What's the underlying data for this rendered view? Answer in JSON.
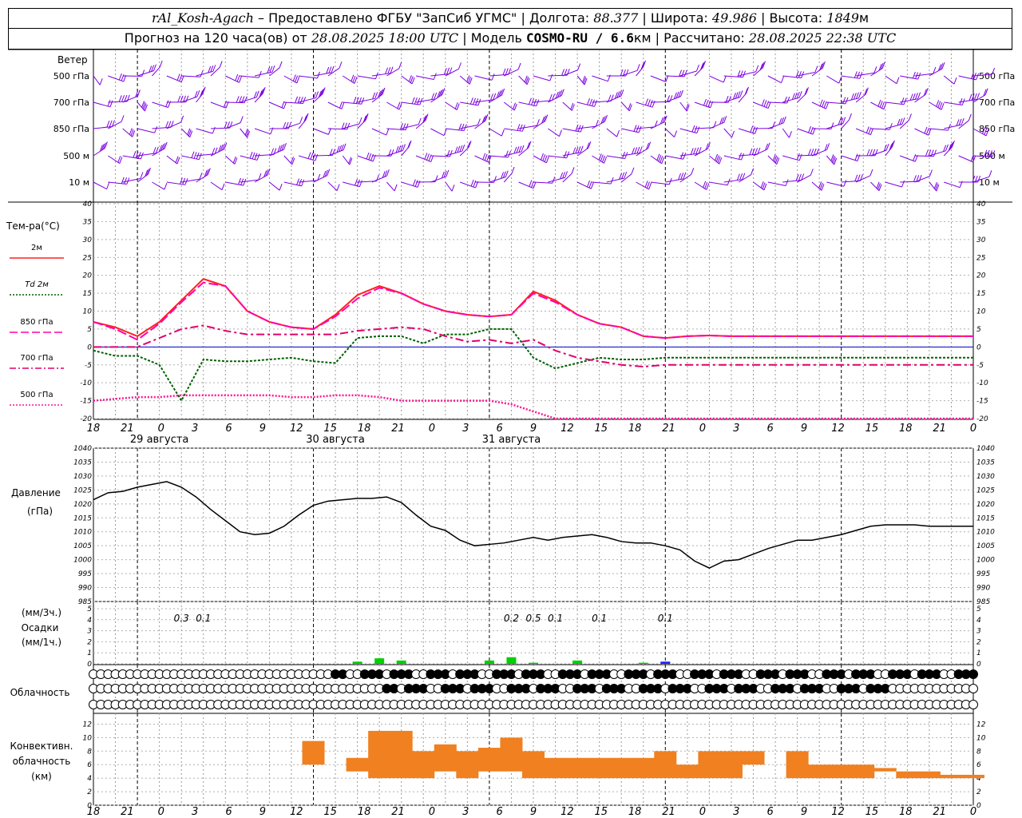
{
  "header": {
    "station": "rAl_Kosh-Agach",
    "provider": "Предоставлено ФГБУ \"ЗапСиб УГМС\"",
    "lon_label": "Долгота:",
    "lon_value": "88.377",
    "lat_label": "Широта:",
    "lat_value": "49.986",
    "alt_label": "Высота:",
    "alt_value": "1849",
    "alt_unit": "м",
    "forecast_label": "Прогноз на 120 часа(ов) от",
    "forecast_start": "28.08.2025 18:00 UTC",
    "model_label": "Модель",
    "model_name": "COSMO-RU / 6.6",
    "model_unit": "км",
    "calc_label": "Рассчитано:",
    "calc_time": "28.08.2025 22:38 UTC"
  },
  "colors": {
    "wind": "#7b00e0",
    "t2m": "#ff2020",
    "td2m": "#006000",
    "t850": "#ff00aa",
    "t700": "#e0006a",
    "t500": "#ff1493",
    "pressure": "#000000",
    "precip3h": "#00d000",
    "precip1h": "#2020ff",
    "convective": "#f08020",
    "zero_line": "#0000cc",
    "grid": "#888888"
  },
  "time_axis": {
    "tick_labels": [
      "18",
      "21",
      "0",
      "3",
      "6",
      "9",
      "12",
      "15",
      "18",
      "21",
      "0",
      "3",
      "6",
      "9",
      "12",
      "15",
      "18",
      "21",
      "0",
      "3",
      "6",
      "9",
      "12",
      "15",
      "18",
      "21",
      "0"
    ],
    "day_labels": [
      "29 августа",
      "30 августа",
      "31 августа"
    ]
  },
  "wind_panel": {
    "title": "Ветер",
    "levels": [
      "500 гПа",
      "700 гПа",
      "850 гПа",
      "500  м",
      "10   м"
    ]
  },
  "temperature_panel": {
    "title": "Тем-ра(°С)",
    "ylim": [
      -20,
      40
    ],
    "yticks": [
      "40",
      "35",
      "30",
      "25",
      "20",
      "15",
      "10",
      "5",
      "0",
      "-5",
      "-10",
      "-15",
      "-20"
    ],
    "legend": [
      {
        "label": "2м",
        "style": "solid",
        "color_key": "t2m"
      },
      {
        "label": "Td 2м",
        "style": "dotted",
        "color_key": "td2m"
      },
      {
        "label": "850 гПа",
        "style": "longdash",
        "color_key": "t850"
      },
      {
        "label": "700 гПа",
        "style": "dashdot",
        "color_key": "t700"
      },
      {
        "label": "500 гПа",
        "style": "dotted",
        "color_key": "t500"
      }
    ]
  },
  "pressure_panel": {
    "title": "Давление",
    "unit": "(гПа)",
    "ylim": [
      985,
      1040
    ],
    "yticks": [
      "1040",
      "1035",
      "1030",
      "1025",
      "1020",
      "1015",
      "1010",
      "1005",
      "1000",
      "995",
      "990",
      "985"
    ]
  },
  "precip_panel": {
    "unit3h": "(мм/3ч.)",
    "title": "Осадки",
    "unit1h": "(мм/1ч.)",
    "yticks": [
      "5",
      "4",
      "3",
      "2",
      "1",
      "0"
    ],
    "annotations": [
      {
        "hour": 9,
        "text": "0.3"
      },
      {
        "hour": 12,
        "text": "0.1"
      },
      {
        "hour": 54,
        "text": "0.2"
      },
      {
        "hour": 57,
        "text": "0.5"
      },
      {
        "hour": 60,
        "text": "0.1"
      },
      {
        "hour": 66,
        "text": "0.1"
      },
      {
        "hour": 75,
        "text": "0.1"
      }
    ]
  },
  "cloud_panel": {
    "title": "Облачность"
  },
  "conv_panel": {
    "title": "Конвективн.",
    "title2": "облачность",
    "unit": "(км)",
    "yticks": [
      "12",
      "10",
      "8",
      "6",
      "4",
      "2",
      "0"
    ]
  },
  "chart_data": [
    {
      "type": "line",
      "title": "Тем-ра(°С)",
      "x_hours_from_start": [
        0,
        3,
        6,
        9,
        12,
        15,
        18,
        21,
        24,
        27,
        30,
        33,
        36,
        39,
        42,
        45,
        48,
        51,
        54,
        57,
        60,
        63,
        66,
        69,
        72,
        75,
        78,
        81,
        84,
        87,
        90,
        93,
        96,
        99,
        102,
        105,
        108,
        111,
        114,
        117,
        120
      ],
      "ylim": [
        -20,
        40
      ],
      "series": [
        {
          "name": "2м",
          "values": [
            7,
            5.5,
            3,
            7,
            13,
            19,
            17,
            10,
            7,
            5.5,
            5,
            9,
            14.5,
            17,
            15,
            12,
            10,
            9,
            8.5,
            9,
            15.5,
            13,
            9,
            6.5,
            5.5,
            3,
            2.5,
            3,
            3.2,
            3,
            3,
            3,
            3,
            3,
            3,
            3,
            3,
            3,
            3,
            3,
            3
          ]
        },
        {
          "name": "Td 2м",
          "values": [
            -1,
            -2.5,
            -2.5,
            -5,
            -15,
            -3.5,
            -4,
            -4,
            -3.5,
            -3,
            -4,
            -4.5,
            2.5,
            3,
            3,
            1,
            3.5,
            3.5,
            5,
            5,
            -3,
            -6,
            -4.5,
            -3,
            -3.5,
            -3.5,
            -3,
            -3,
            -3,
            -3,
            -3,
            -3,
            -3,
            -3,
            -3,
            -3,
            -3,
            -3,
            -3,
            -3,
            -3
          ]
        },
        {
          "name": "850 гПа",
          "values": [
            7,
            5,
            2,
            6.5,
            12.5,
            18,
            17,
            10,
            7,
            5.5,
            5,
            8.5,
            13.5,
            16.5,
            15,
            12,
            10,
            9,
            8.5,
            9,
            15,
            12.5,
            9,
            6.5,
            5.5,
            3,
            2.5,
            3,
            3.2,
            3,
            3,
            3,
            3,
            3,
            3,
            3,
            3,
            3,
            3,
            3,
            3
          ]
        },
        {
          "name": "700 гПа",
          "values": [
            0,
            0,
            0,
            2.5,
            5,
            6,
            4.5,
            3.5,
            3.5,
            3.5,
            3.5,
            3.5,
            4.5,
            5,
            5.5,
            5,
            3,
            1.5,
            2,
            1,
            2,
            -1,
            -3,
            -4,
            -5,
            -5.5,
            -5,
            -5,
            -5,
            -5,
            -5,
            -5,
            -5,
            -5,
            -5,
            -5,
            -5,
            -5,
            -5,
            -5,
            -5
          ]
        },
        {
          "name": "500 гПа",
          "values": [
            -15,
            -14.5,
            -14,
            -14,
            -13.5,
            -13.5,
            -13.5,
            -13.5,
            -13.5,
            -14,
            -14,
            -13.5,
            -13.5,
            -14,
            -15,
            -15,
            -15,
            -15,
            -15,
            -16,
            -18,
            -20,
            -20,
            -20,
            -20,
            -20,
            -20,
            -20,
            -20,
            -20,
            -20,
            -20,
            -20,
            -20,
            -20,
            -20,
            -20,
            -20,
            -20,
            -20,
            -20
          ]
        }
      ]
    },
    {
      "type": "line",
      "title": "Давление",
      "x_hours_from_start": [
        0,
        2,
        4,
        6,
        8,
        10,
        12,
        14,
        16,
        18,
        20,
        22,
        24,
        26,
        28,
        30,
        32,
        34,
        36,
        38,
        40,
        42,
        44,
        46,
        48,
        50,
        52,
        54,
        56,
        58,
        60,
        62,
        64,
        66,
        68,
        70,
        72,
        74,
        76,
        78,
        80,
        82,
        84,
        86,
        88,
        90,
        92,
        94,
        96,
        98,
        100,
        102,
        104,
        106,
        108,
        110,
        112,
        114,
        116,
        118,
        120
      ],
      "ylim": [
        985,
        1040
      ],
      "series": [
        {
          "name": "Давление",
          "values": [
            1021.5,
            1024,
            1024.5,
            1026,
            1027,
            1028,
            1026,
            1022.5,
            1018,
            1014,
            1010,
            1009,
            1009.5,
            1012,
            1016,
            1019.5,
            1021,
            1021.5,
            1022,
            1022,
            1022.5,
            1020.5,
            1016,
            1012,
            1010.5,
            1007,
            1005,
            1005.5,
            1006,
            1007,
            1008,
            1007,
            1008,
            1008.5,
            1009,
            1008,
            1006.5,
            1006,
            1006,
            1005,
            1003.5,
            999.5,
            997,
            999.5,
            1000,
            1002,
            1004,
            1005.5,
            1007,
            1007,
            1008,
            1009,
            1010.5,
            1012,
            1012.5,
            1012.5,
            1012.5,
            1012,
            1012,
            1012,
            1012
          ]
        }
      ]
    },
    {
      "type": "bar",
      "title": "Осадки",
      "x_hours_from_start": [
        36,
        39,
        42,
        54,
        57,
        60,
        66,
        75,
        78
      ],
      "series": [
        {
          "name": "мм/3ч.",
          "values": [
            0.2,
            0.5,
            0.3,
            0.3,
            0.6,
            0.1,
            0.3,
            0.1,
            0.1
          ]
        },
        {
          "name": "мм/1ч.",
          "values": [
            0,
            0,
            0,
            0,
            0,
            0,
            0,
            0,
            0.2
          ]
        }
      ]
    },
    {
      "type": "bar",
      "title": "Конвективн. облачность",
      "x_hours_from_start": [
        27,
        30,
        36,
        39,
        42,
        45,
        48,
        51,
        54,
        57,
        60,
        63,
        66,
        69,
        72,
        75,
        78,
        81,
        84,
        87,
        90,
        93,
        96,
        99,
        102,
        105,
        108,
        111,
        114,
        117,
        120
      ],
      "series": [
        {
          "name": "base",
          "values": [
            6,
            6,
            5,
            4,
            4,
            4,
            5,
            4,
            5,
            5,
            4,
            4,
            4,
            4,
            4,
            4,
            4,
            4,
            4,
            4,
            6,
            6,
            4,
            4,
            4,
            4,
            5,
            4,
            4,
            4,
            4
          ]
        },
        {
          "name": "top",
          "values": [
            6,
            9.5,
            7,
            11,
            11,
            8,
            9,
            8,
            8.5,
            10,
            8,
            7,
            7,
            7,
            7,
            7,
            8,
            6,
            8,
            8,
            8,
            6,
            8,
            6,
            6,
            6,
            5.5,
            5,
            5,
            4.5,
            4.5
          ]
        }
      ]
    }
  ]
}
